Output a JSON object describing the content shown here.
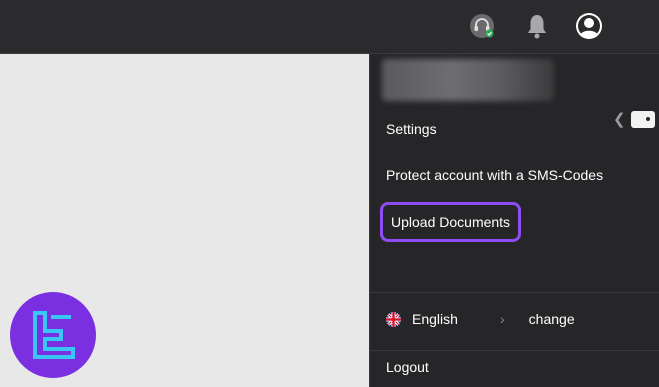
{
  "header": {
    "icons": [
      "support-headset-icon",
      "notification-bell-icon",
      "user-profile-icon"
    ]
  },
  "menu": {
    "items": [
      {
        "label": "Settings"
      },
      {
        "label": "Protect account with a SMS-Codes"
      },
      {
        "label": "Upload Documents"
      }
    ],
    "language": {
      "label": "English",
      "change_label": "change"
    },
    "logout_label": "Logout"
  },
  "colors": {
    "topbar_bg": "#2b2b2d",
    "menu_bg": "#262628",
    "highlight": "#8d4df2",
    "logo_bg": "#7a2fe0",
    "logo_mark": "#39c5f5"
  }
}
